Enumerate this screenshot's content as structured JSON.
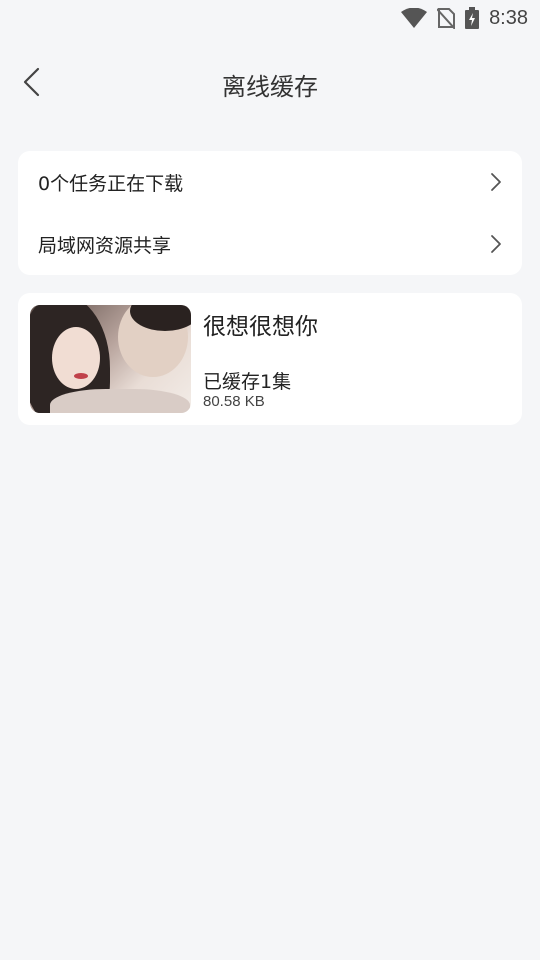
{
  "status_bar": {
    "time": "8:38",
    "icons": [
      "wifi-icon",
      "no-sim-icon",
      "battery-charging-icon"
    ]
  },
  "header": {
    "title": "离线缓存",
    "back_icon": "chevron-left-icon"
  },
  "menu": {
    "items": [
      {
        "label": "0个任务正在下载",
        "icon": "chevron-right-icon"
      },
      {
        "label": "局域网资源共享",
        "icon": "chevron-right-icon"
      }
    ]
  },
  "cached": {
    "items": [
      {
        "title": "很想很想你",
        "count": "已缓存1集",
        "size": "80.58 KB"
      }
    ]
  }
}
